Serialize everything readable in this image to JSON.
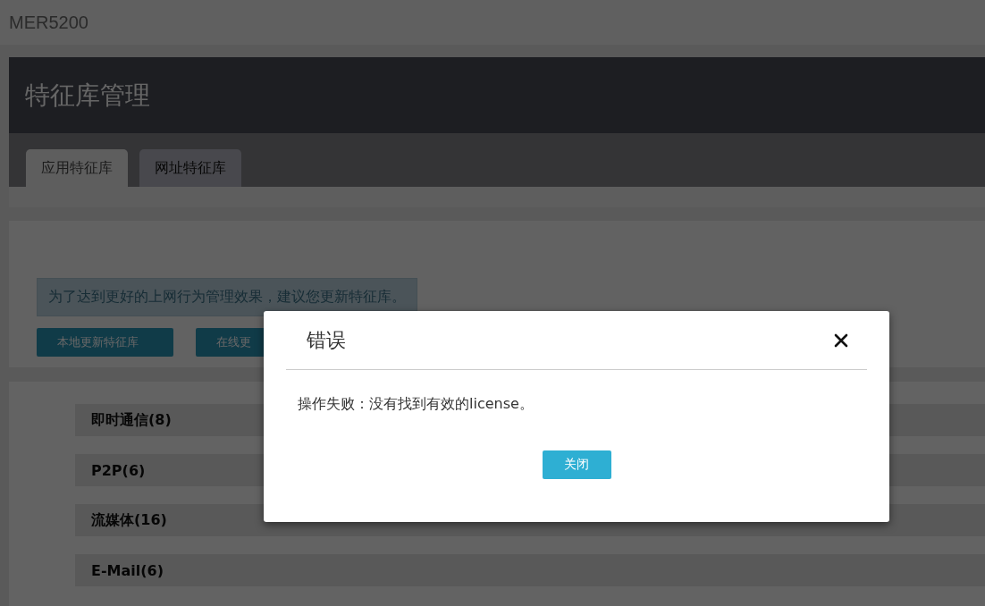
{
  "app": {
    "title": "MER5200"
  },
  "page": {
    "title": "特征库管理"
  },
  "tabs": [
    {
      "label": "应用特征库",
      "selected": true
    },
    {
      "label": "网址特征库",
      "selected": false
    }
  ],
  "notice": "为了达到更好的上网行为管理效果，建议您更新特征库。",
  "actions": [
    "本地更新特征库",
    "在线更"
  ],
  "categories": [
    "即时通信(8)",
    "P2P(6)",
    "流媒体(16)",
    "E-Mail(6)"
  ],
  "dialog": {
    "title": "错误",
    "message": "操作失败：没有找到有效的license。",
    "buttons": [
      "关闭"
    ]
  }
}
